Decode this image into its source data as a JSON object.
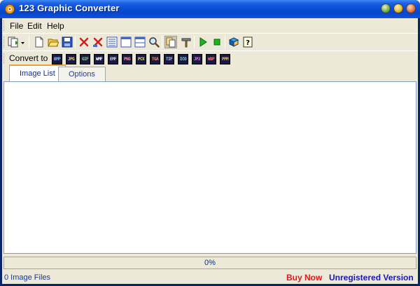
{
  "window": {
    "title": "123 Graphic Converter",
    "buttons": [
      "minimize-green",
      "maximize-yellow",
      "close-orange"
    ]
  },
  "menu": {
    "items": [
      {
        "label": "File"
      },
      {
        "label": "Edit"
      },
      {
        "label": "Help"
      }
    ]
  },
  "toolbar": {
    "icons": [
      "add-files-dropdown-icon",
      "new-file-icon",
      "open-folder-icon",
      "save-icon",
      "delete-icon",
      "clear-icon",
      "list-view-icon",
      "window-view-icon",
      "split-view-icon",
      "zoom-icon",
      "copy-icon",
      "tools-icon",
      "start-icon",
      "stop-icon",
      "book-icon",
      "help-icon"
    ]
  },
  "convert": {
    "label": "Convert to",
    "formats": [
      {
        "label": "BMP",
        "color": "#7fb3ff"
      },
      {
        "label": "JPG",
        "color": "#ffd84a"
      },
      {
        "label": "GIF",
        "color": "#7dea5a"
      },
      {
        "label": "WMF",
        "color": "#ffffff"
      },
      {
        "label": "EMF",
        "color": "#d0d0d0"
      },
      {
        "label": "PNG",
        "color": "#ff8c8c"
      },
      {
        "label": "PCX",
        "color": "#f2e04a"
      },
      {
        "label": "TGA",
        "color": "#ff8f4a"
      },
      {
        "label": "TIF",
        "color": "#9cc8ff"
      },
      {
        "label": "ICO",
        "color": "#6ae0e0"
      },
      {
        "label": "JP2",
        "color": "#ff6ae0"
      },
      {
        "label": "WBP",
        "color": "#ff6a6a"
      },
      {
        "label": "PPM",
        "color": "#ffb84a"
      }
    ]
  },
  "tabs": [
    {
      "label": "Image List",
      "selected": true
    },
    {
      "label": "Options",
      "selected": false
    }
  ],
  "progress": {
    "value": 0,
    "label": "0%"
  },
  "status": {
    "file_count": "0 Image Files",
    "buy_now": "Buy Now",
    "registration": "Unregistered Version"
  },
  "colors": {
    "buy_now": "#e01818",
    "registration": "#1818b8",
    "titlebar": "#0a4fd6"
  }
}
